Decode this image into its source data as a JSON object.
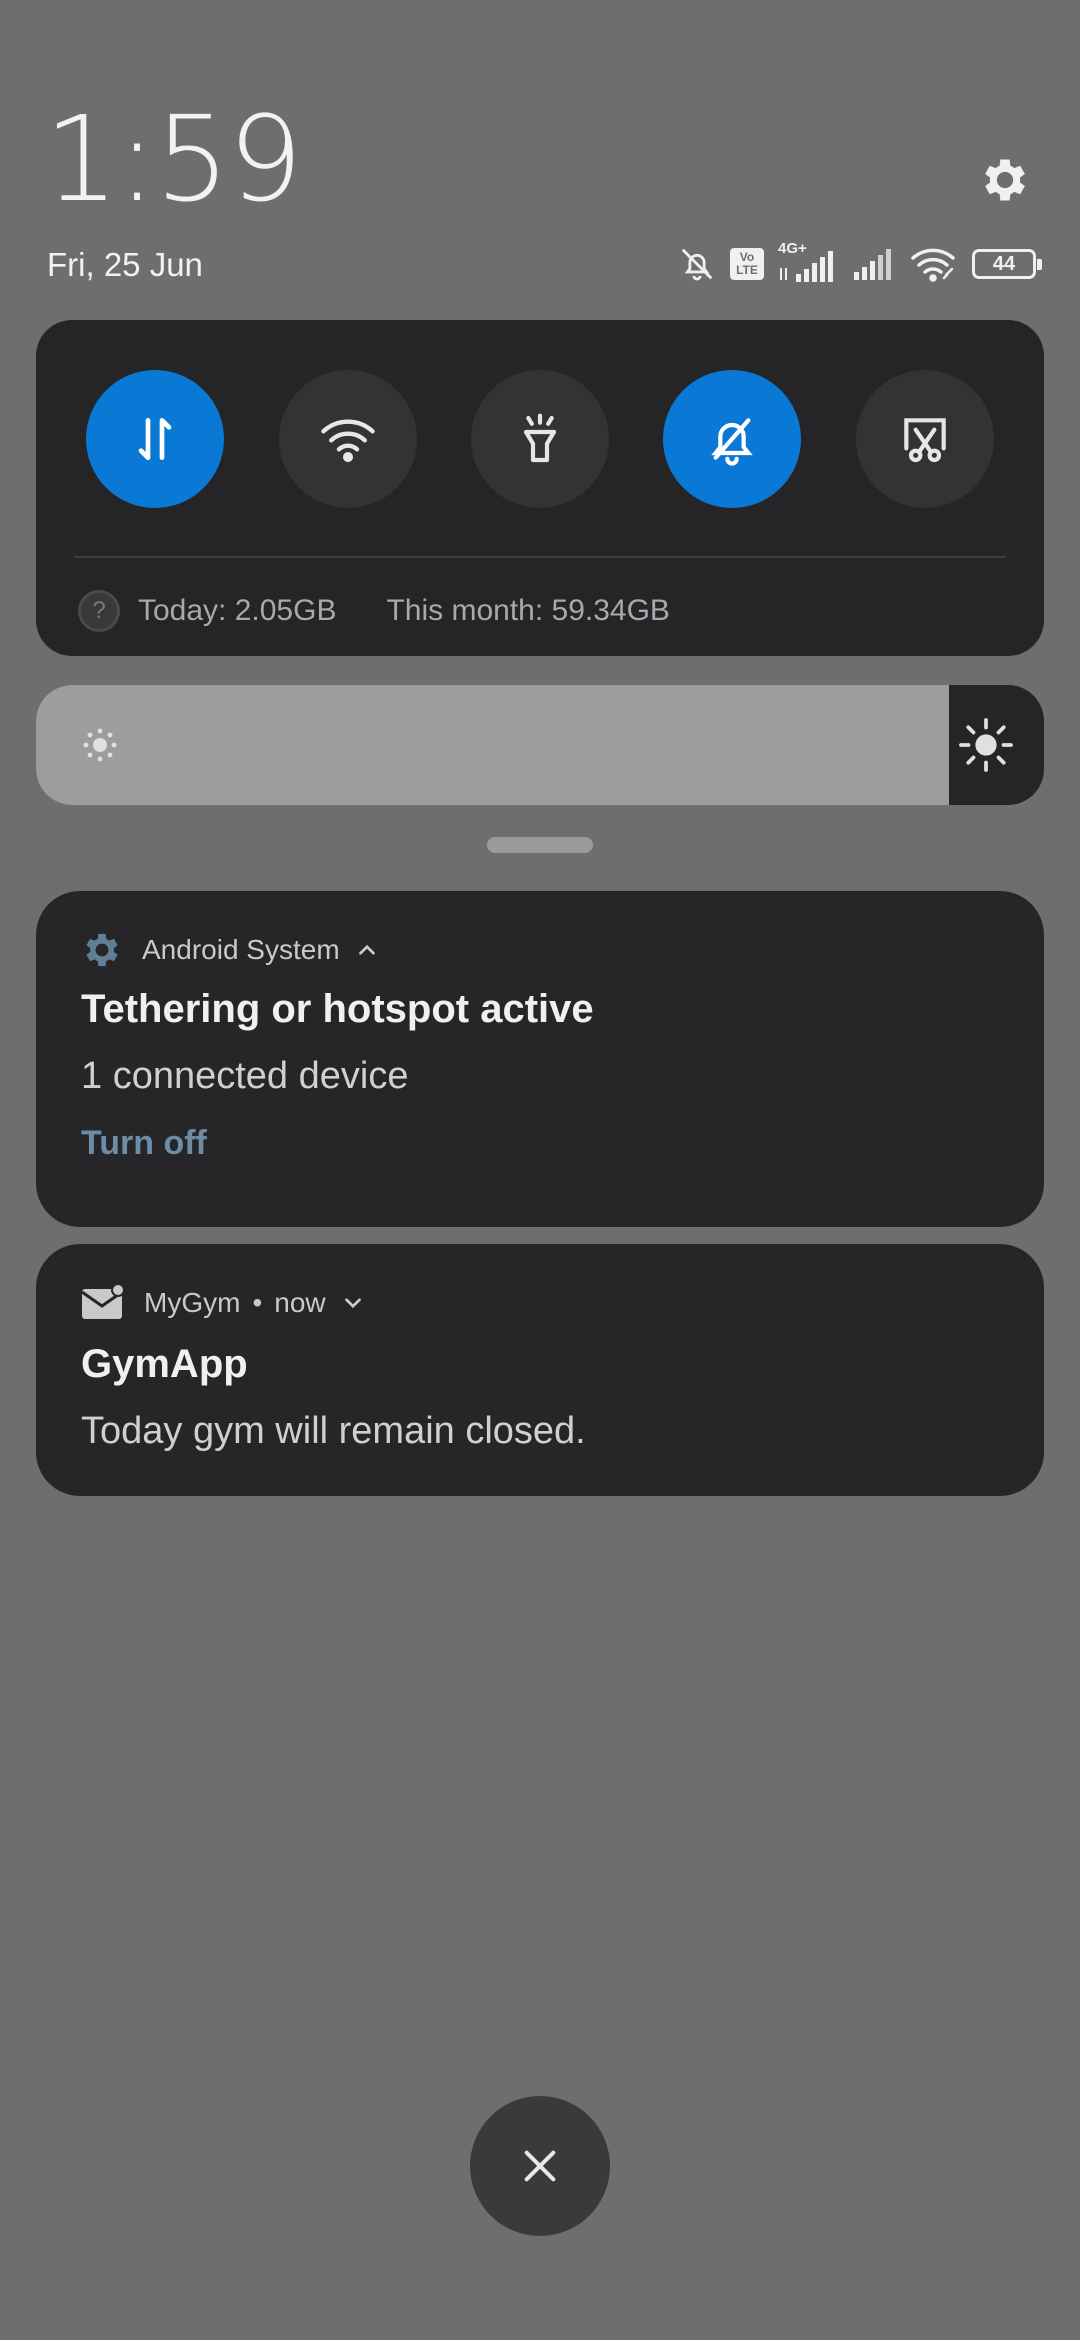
{
  "clock": {
    "time": "1:59",
    "date": "Fri, 25 Jun"
  },
  "status_bar": {
    "icons": [
      "alarm-off-icon",
      "volte-icon",
      "signal-4g-icon",
      "signal-icon",
      "wifi-hotspot-icon",
      "battery-icon"
    ],
    "network_label": "4G+",
    "volte_top": "Vo",
    "volte_bottom": "LTE",
    "battery_level": "44"
  },
  "quick_settings": {
    "tiles": [
      {
        "name": "mobile-data",
        "icon": "data-arrows-icon",
        "active": true
      },
      {
        "name": "wifi",
        "icon": "wifi-icon",
        "active": false
      },
      {
        "name": "flashlight",
        "icon": "flashlight-icon",
        "active": false
      },
      {
        "name": "mute",
        "icon": "bell-off-icon",
        "active": true
      },
      {
        "name": "screenshot",
        "icon": "screenshot-scissors-icon",
        "active": false
      }
    ],
    "data_usage": {
      "help_glyph": "?",
      "today": "Today: 2.05GB",
      "month": "This month: 59.34GB"
    },
    "active_color": "#0a79d6"
  },
  "brightness": {
    "level": 0.906
  },
  "notifications": [
    {
      "app": "Android System",
      "app_icon": "gear-icon",
      "title": "Tethering or hotspot active",
      "text": "1 connected device",
      "action": "Turn off",
      "expanded": true
    },
    {
      "app": "MyGym",
      "app_icon": "mail-icon",
      "dot": "•",
      "time": "now",
      "title": "GymApp",
      "text": "Today gym will remain closed.",
      "expanded": false
    }
  ],
  "dismiss_icon": "close-icon"
}
